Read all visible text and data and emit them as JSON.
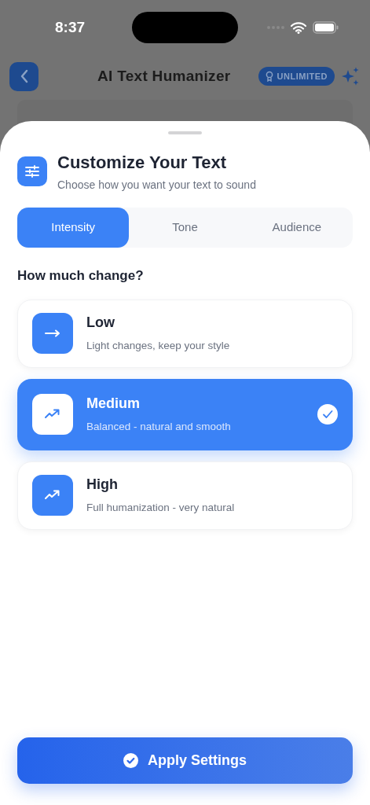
{
  "status_bar": {
    "time": "8:37"
  },
  "header": {
    "title": "AI Text Humanizer",
    "badge": "UNLIMITED"
  },
  "sheet": {
    "title": "Customize Your Text",
    "subtitle": "Choose how you want your text to sound",
    "tabs": [
      {
        "label": "Intensity",
        "selected": true
      },
      {
        "label": "Tone",
        "selected": false
      },
      {
        "label": "Audience",
        "selected": false
      }
    ],
    "section_title": "How much change?",
    "options": [
      {
        "title": "Low",
        "description": "Light changes, keep your style",
        "selected": false
      },
      {
        "title": "Medium",
        "description": "Balanced - natural and smooth",
        "selected": true
      },
      {
        "title": "High",
        "description": "Full humanization - very natural",
        "selected": false
      }
    ],
    "apply_button": "Apply Settings"
  }
}
